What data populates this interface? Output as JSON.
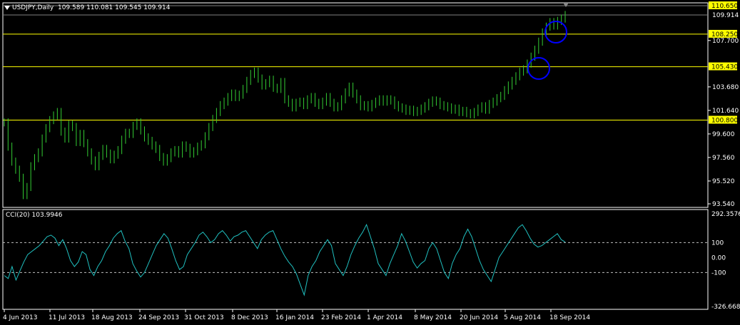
{
  "header": {
    "symbol": "USDJPY,Daily",
    "ohlc": "109.589 110.081 109.545 109.914"
  },
  "indicator": {
    "label": "CCI(20) 103.9946"
  },
  "colors": {
    "background": "#000000",
    "candles": "#33cc33",
    "levels": "#ffff00",
    "cci": "#20c0c0",
    "circles": "#0000ff",
    "axis_text": "#ffffff",
    "grid": "#808080"
  },
  "chart_data": [
    {
      "type": "line",
      "title": "USDJPY,Daily",
      "x_ticks": [
        "4 Jun 2013",
        "11 Jul 2013",
        "18 Aug 2013",
        "24 Sep 2013",
        "31 Oct 2013",
        "8 Dec 2013",
        "16 Jan 2014",
        "23 Feb 2014",
        "1 Apr 2014",
        "8 May 2014",
        "20 Jun 2014",
        "5 Aug 2014",
        "18 Sep 2014"
      ],
      "y_ticks": [
        "109.914",
        "107.700",
        "105.430",
        "103.680",
        "101.640",
        "99.600",
        "97.560",
        "95.520",
        "93.540"
      ],
      "ylim": [
        93.54,
        111.3
      ],
      "price_labels": {
        "current": 109.914,
        "levels": [
          110.65,
          108.25,
          105.43,
          100.8
        ]
      },
      "y_tick_values": [
        107.7,
        103.68,
        101.64,
        99.6,
        97.56,
        95.52,
        93.54
      ],
      "series": [
        {
          "values": [
            100.6,
            98.5,
            97.2,
            96.5,
            95.8,
            94.3,
            95.0,
            96.8,
            97.5,
            98.0,
            99.2,
            100.1,
            100.8,
            101.2,
            101.5,
            99.8,
            99.2,
            100.4,
            100.2,
            98.9,
            99.6,
            98.8,
            98.0,
            97.3,
            96.8,
            97.7,
            98.3,
            97.9,
            97.4,
            97.8,
            98.2,
            99.1,
            99.7,
            99.6,
            100.3,
            100.6,
            99.9,
            99.3,
            99.0,
            98.6,
            98.3,
            97.6,
            97.2,
            97.5,
            98.0,
            98.2,
            97.9,
            98.6,
            98.4,
            97.9,
            98.1,
            98.5,
            98.7,
            99.4,
            100.2,
            100.9,
            101.5,
            102.1,
            102.4,
            102.8,
            103.1,
            102.8,
            103.0,
            103.5,
            104.2,
            104.8,
            105.0,
            104.4,
            103.8,
            104.0,
            104.3,
            103.6,
            103.5,
            104.1,
            102.6,
            102.3,
            101.9,
            102.3,
            102.4,
            102.1,
            102.6,
            102.8,
            102.3,
            102.1,
            102.4,
            102.8,
            102.3,
            101.9,
            102.0,
            102.6,
            103.2,
            103.7,
            103.1,
            102.6,
            102.0,
            102.1,
            101.9,
            102.2,
            102.4,
            102.6,
            102.4,
            102.6,
            102.5,
            102.1,
            101.9,
            101.8,
            101.6,
            101.7,
            101.5,
            101.6,
            101.8,
            102.0,
            102.3,
            102.5,
            102.4,
            102.1,
            102.0,
            101.9,
            101.7,
            101.8,
            101.5,
            101.6,
            101.4,
            101.3,
            101.5,
            101.8,
            102.0,
            101.7,
            102.2,
            102.4,
            102.7,
            102.9,
            103.4,
            103.8,
            104.2,
            104.6,
            105.0,
            105.2,
            105.7,
            106.3,
            106.9,
            107.6,
            108.4,
            108.9,
            109.3,
            109.0,
            109.4,
            109.6,
            109.914
          ]
        }
      ]
    },
    {
      "type": "line",
      "title": "CCI(20) 103.9946",
      "y_ticks": [
        "292.3576",
        "100",
        "0.00",
        "-100",
        "-326.6682"
      ],
      "ylim": [
        -326.6682,
        292.3576
      ],
      "levels": [
        100,
        -100
      ],
      "series": [
        {
          "name": "CCI(20)",
          "values": [
            -120,
            -140,
            -60,
            -150,
            -90,
            -30,
            20,
            40,
            60,
            80,
            110,
            140,
            150,
            130,
            80,
            120,
            60,
            -20,
            -60,
            -30,
            40,
            20,
            -80,
            -120,
            -60,
            -20,
            40,
            80,
            130,
            160,
            180,
            110,
            60,
            -40,
            -90,
            -130,
            -100,
            -40,
            20,
            80,
            120,
            160,
            130,
            60,
            -20,
            -80,
            -60,
            20,
            60,
            100,
            150,
            170,
            140,
            100,
            120,
            160,
            180,
            150,
            110,
            140,
            150,
            170,
            180,
            140,
            100,
            60,
            120,
            150,
            170,
            180,
            120,
            60,
            10,
            -30,
            -60,
            -110,
            -180,
            -250,
            -120,
            -60,
            -20,
            40,
            80,
            120,
            80,
            -40,
            -80,
            -120,
            -60,
            20,
            80,
            130,
            170,
            220,
            140,
            60,
            -40,
            -80,
            -120,
            -40,
            20,
            80,
            160,
            110,
            40,
            -30,
            -70,
            -40,
            -20,
            60,
            100,
            60,
            -20,
            -100,
            -140,
            -40,
            20,
            60,
            140,
            190,
            140,
            60,
            -20,
            -80,
            -120,
            -160,
            -80,
            0,
            40,
            80,
            120,
            160,
            200,
            220,
            180,
            130,
            90,
            70,
            80,
            100,
            120,
            140,
            160,
            120,
            103.9946
          ]
        }
      ]
    }
  ]
}
